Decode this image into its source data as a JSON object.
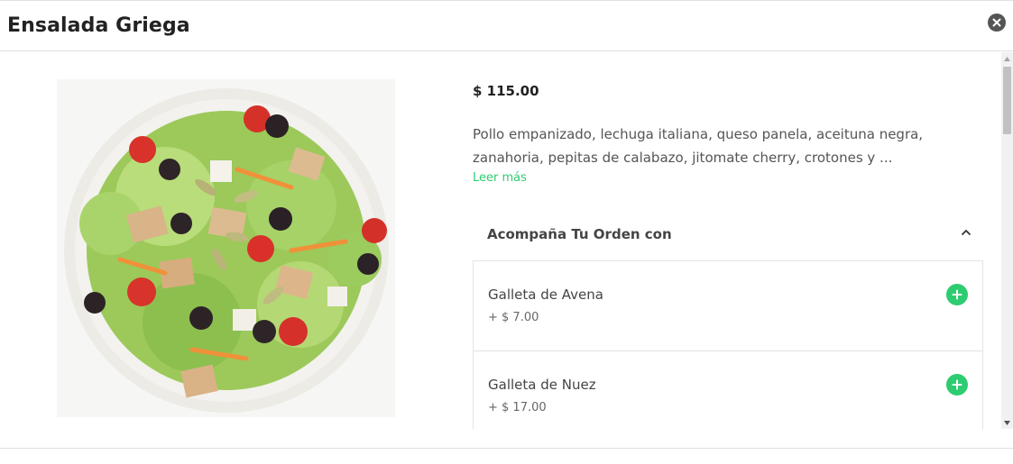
{
  "header": {
    "title": "Ensalada Griega",
    "close_icon": "close-icon"
  },
  "product": {
    "image_alt": "salad-bowl",
    "price": "$ 115.00",
    "description": "Pollo empanizado, lechuga italiana, queso panela, aceituna negra, zanahoria, pepitas de calabazo, jitomate cherry, crotones y ...",
    "read_more": "Leer más"
  },
  "extras": {
    "title": "Acompaña Tu Orden con",
    "collapse_icon": "chevron-up-icon",
    "items": [
      {
        "name": "Galleta de Avena",
        "price": "+ $ 7.00",
        "icon": "plus-icon"
      },
      {
        "name": "Galleta de Nuez",
        "price": "+ $ 17.00",
        "icon": "plus-icon"
      }
    ]
  },
  "colors": {
    "accent": "#2ecc71",
    "text": "#333333",
    "close_bg": "#555555"
  }
}
